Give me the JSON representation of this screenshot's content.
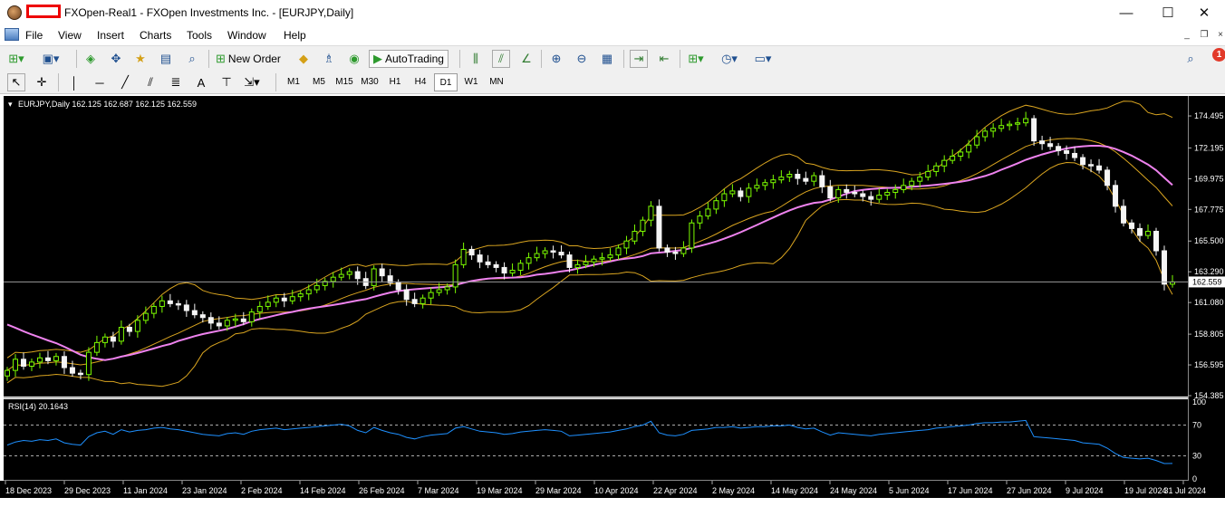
{
  "window": {
    "title": "FXOpen-Real1 - FXOpen Investments Inc. - [EURJPY,Daily]",
    "minimize": "—",
    "maximize": "☐",
    "close": "✕"
  },
  "menu": {
    "items": [
      "File",
      "View",
      "Insert",
      "Charts",
      "Tools",
      "Window",
      "Help"
    ],
    "mdi_minimize": "_",
    "mdi_restore": "❐",
    "mdi_close": "×"
  },
  "toolbar": {
    "new_order_label": "New Order",
    "autotrading_label": "AutoTrading",
    "notification_count": "1",
    "timeframes": [
      "M1",
      "M5",
      "M15",
      "M30",
      "H1",
      "H4",
      "D1",
      "W1",
      "MN"
    ],
    "active_timeframe": "D1"
  },
  "colors": {
    "chart_bg": "#000000",
    "candle_up": "#7CFC00",
    "candle_down": "#F5F5F5",
    "bollinger": "#DAA520",
    "ma": "#EE82EE",
    "rsi": "#1E90FF",
    "current_price_bg": "#ffffff"
  },
  "chart_data": [
    {
      "type": "candlestick",
      "header": "EURJPY,Daily  162.125 162.687 162.125 162.559",
      "current_price": 162.559,
      "current_price_label": "162.559",
      "y_ticks": [
        "174.495",
        "172.195",
        "169.975",
        "167.775",
        "165.500",
        "163.290",
        "161.080",
        "158.805",
        "156.595",
        "154.385"
      ],
      "ylim": [
        154.385,
        175.8
      ],
      "x_ticks": [
        "18 Dec 2023",
        "29 Dec 2023",
        "11 Jan 2024",
        "23 Jan 2024",
        "2 Feb 2024",
        "14 Feb 2024",
        "26 Feb 2024",
        "7 Mar 2024",
        "19 Mar 2024",
        "29 Mar 2024",
        "10 Apr 2024",
        "22 Apr 2024",
        "2 May 2024",
        "14 May 2024",
        "24 May 2024",
        "5 Jun 2024",
        "17 Jun 2024",
        "27 Jun 2024",
        "9 Jul 2024",
        "19 Jul 2024",
        "31 Jul 2024"
      ],
      "close_series": [
        156.2,
        157.0,
        156.5,
        156.8,
        157.1,
        156.9,
        157.2,
        156.4,
        156.0,
        155.9,
        157.5,
        158.2,
        158.6,
        158.3,
        159.3,
        159.0,
        159.8,
        160.3,
        160.8,
        161.2,
        161.0,
        160.9,
        160.5,
        160.2,
        160.0,
        159.6,
        159.4,
        159.8,
        159.9,
        159.7,
        160.4,
        160.8,
        161.1,
        161.4,
        161.2,
        161.5,
        161.7,
        162.0,
        162.3,
        162.6,
        162.9,
        163.1,
        163.3,
        162.8,
        162.3,
        163.5,
        163.0,
        162.5,
        162.0,
        161.3,
        161.0,
        161.4,
        161.8,
        162.0,
        162.2,
        163.8,
        164.9,
        164.5,
        164.0,
        163.8,
        163.6,
        163.2,
        163.4,
        163.9,
        164.3,
        164.6,
        164.8,
        164.7,
        164.5,
        163.6,
        163.8,
        164.0,
        164.2,
        164.3,
        164.5,
        165.0,
        165.5,
        166.2,
        167.0,
        168.0,
        165.0,
        164.7,
        164.6,
        165.0,
        166.8,
        167.3,
        167.8,
        168.4,
        168.9,
        169.1,
        168.7,
        169.3,
        169.5,
        169.7,
        169.9,
        170.1,
        170.3,
        170.0,
        169.8,
        170.2,
        169.4,
        168.6,
        169.2,
        169.0,
        168.9,
        168.7,
        168.5,
        168.8,
        169.0,
        169.2,
        169.5,
        169.8,
        170.1,
        170.5,
        170.9,
        171.3,
        171.6,
        171.9,
        172.4,
        173.0,
        173.4,
        173.6,
        173.8,
        173.9,
        174.0,
        174.3,
        172.7,
        172.5,
        172.3,
        172.0,
        171.8,
        171.5,
        171.0,
        170.9,
        170.6,
        169.5,
        168.0,
        166.8,
        166.4,
        165.9,
        166.2,
        164.8,
        162.4,
        162.559
      ],
      "moving_average": {
        "start": 159.5,
        "trough": 158.5,
        "end": 170.6
      },
      "bollinger_bands": true
    },
    {
      "type": "line",
      "header": "RSI(14) 20.1643",
      "levels": [
        70,
        30
      ],
      "y_ticks": [
        "100",
        "70",
        "30",
        "0"
      ],
      "ylim": [
        0,
        100
      ],
      "values": [
        44,
        48,
        50,
        49,
        51,
        50,
        52,
        47,
        45,
        44,
        55,
        60,
        62,
        58,
        64,
        61,
        63,
        64,
        66,
        67,
        65,
        64,
        62,
        60,
        58,
        57,
        56,
        59,
        60,
        58,
        62,
        64,
        65,
        66,
        64,
        65,
        66,
        67,
        68,
        69,
        70,
        71,
        69,
        63,
        60,
        67,
        63,
        60,
        58,
        54,
        52,
        55,
        57,
        58,
        59,
        66,
        68,
        65,
        62,
        61,
        60,
        58,
        59,
        61,
        62,
        63,
        64,
        63,
        62,
        56,
        57,
        58,
        59,
        60,
        61,
        63,
        65,
        68,
        70,
        75,
        60,
        57,
        56,
        58,
        63,
        64,
        65,
        67,
        67,
        68,
        66,
        67,
        68,
        68,
        69,
        69,
        70,
        67,
        65,
        66,
        61,
        57,
        60,
        59,
        58,
        57,
        56,
        58,
        59,
        60,
        61,
        62,
        63,
        64,
        66,
        67,
        68,
        69,
        70,
        72,
        73,
        73,
        74,
        74,
        75,
        76,
        55,
        54,
        53,
        52,
        51,
        50,
        47,
        46,
        45,
        40,
        33,
        28,
        27,
        26,
        27,
        24,
        20,
        20.1643
      ]
    }
  ]
}
